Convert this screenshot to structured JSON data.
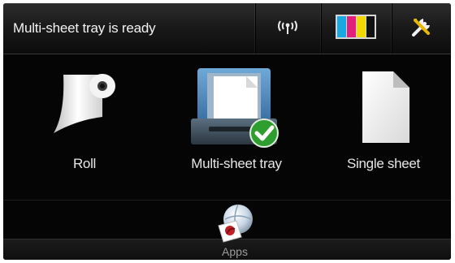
{
  "status_bar": {
    "message": "Multi-sheet tray is ready",
    "icons": [
      "wireless-icon",
      "ink-cartridges-icon",
      "setup-tools-icon"
    ]
  },
  "media_options": [
    {
      "label": "Roll",
      "icon": "paper-roll-icon",
      "selected": false
    },
    {
      "label": "Multi-sheet tray",
      "icon": "multi-sheet-tray-icon",
      "selected": true
    },
    {
      "label": "Single sheet",
      "icon": "single-sheet-icon",
      "selected": false
    }
  ],
  "apps": {
    "label": "Apps",
    "icon": "apps-globe-icon"
  },
  "colors": {
    "background": "#050505",
    "text": "#e6e6e6",
    "check_green": "#2e9e2e",
    "ink": [
      "#1aa8e0",
      "#e0207a",
      "#f0d800",
      "#111111"
    ]
  }
}
